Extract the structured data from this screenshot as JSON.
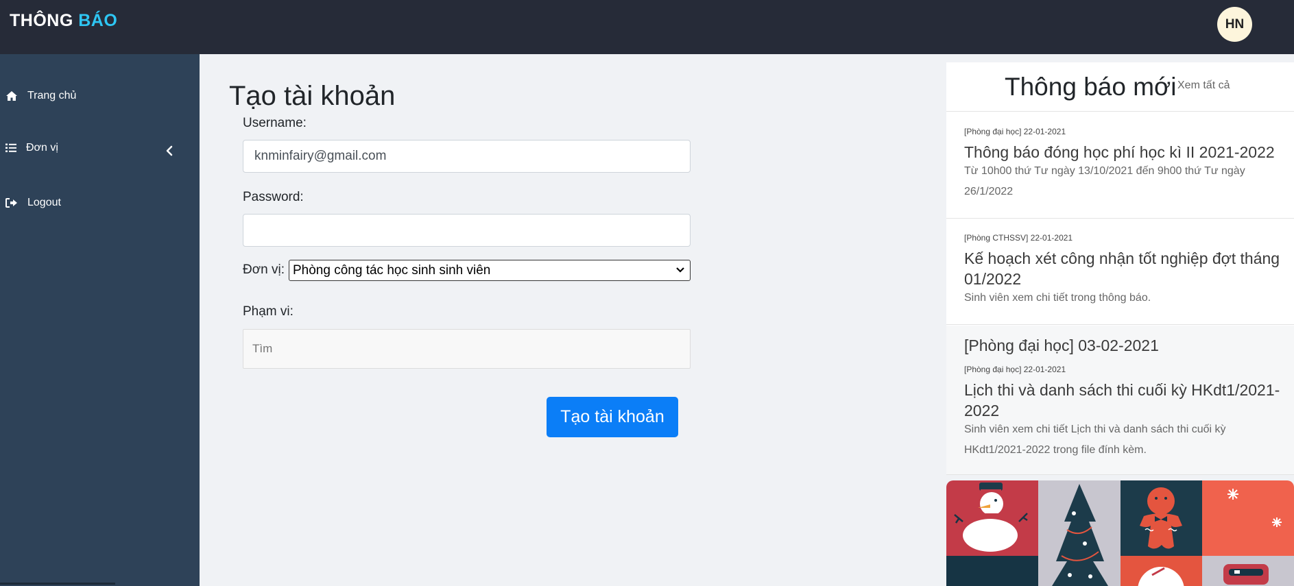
{
  "header": {
    "logo_main": "THÔNG ",
    "logo_accent": "BÁO",
    "avatar_initials": "HN",
    "colors": {
      "topbar": "#262b38",
      "logo_accent": "#2ec6f3",
      "avatar_bg": "#fdf5dc"
    }
  },
  "sidebar": {
    "items": [
      {
        "label": "Trang chủ",
        "icon": "home-icon"
      },
      {
        "label": "Đơn vị",
        "icon": "list-icon"
      },
      {
        "label": "Logout",
        "icon": "sign-out-icon"
      }
    ],
    "collapse_icon": "chevron-left-icon",
    "colors": {
      "bg": "#2e4258"
    }
  },
  "form": {
    "title": "Tạo tài khoản",
    "username_label": "Username:",
    "username_value": "knminfairy@gmail.com",
    "password_label": "Password:",
    "password_value": "",
    "unit_label": "Đơn vị:",
    "unit_selected": "Phòng công tác học sinh sinh viên",
    "scope_label": "Phạm vi:",
    "scope_placeholder": "Tìm",
    "submit_label": "Tạo tài khoản",
    "colors": {
      "submit_bg": "#0b7ef7"
    }
  },
  "notifications": {
    "title": "Thông báo mới",
    "view_all": "Xem tất cả",
    "items": [
      {
        "meta": "[Phòng đại học] 22-01-2021",
        "title": "Thông báo đóng học phí học kì II 2021-2022",
        "desc": "Từ 10h00 thứ Tư ngày 13/10/2021 đến 9h00 thứ Tư ngày 26/1/2022"
      },
      {
        "meta": "[Phòng CTHSSV] 22-01-2021",
        "title": "Kế hoạch xét công nhận tốt nghiệp đợt tháng 01/2022",
        "desc": "Sinh viên xem chi tiết trong thông báo."
      },
      {
        "big_meta": "[Phòng đại học] 03-02-2021",
        "meta": "[Phòng đại học] 22-01-2021",
        "title": "Lịch thi và danh sách thi cuối kỳ HKdt1/2021-2022",
        "desc": "Sinh viên xem chi tiết Lịch thi và danh sách thi cuối kỳ HKdt1/2021-2022 trong file đính kèm."
      }
    ]
  },
  "banner": {
    "illustration": "christmas-pattern-illustration"
  }
}
